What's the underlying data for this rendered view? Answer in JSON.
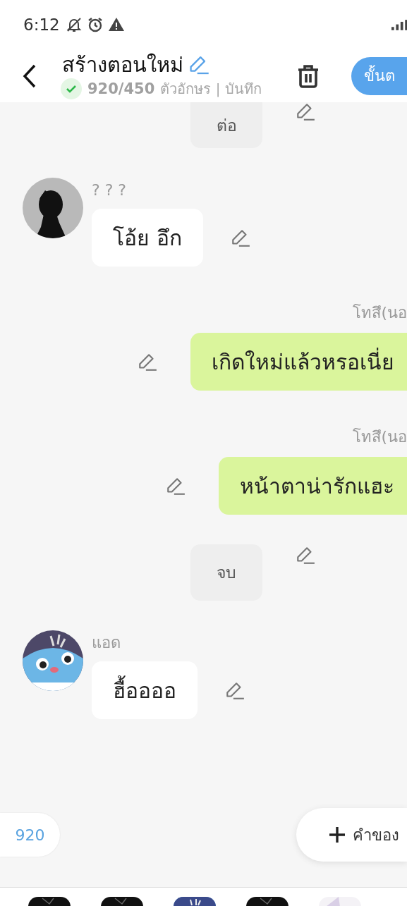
{
  "status_bar": {
    "time": "6:12"
  },
  "header": {
    "title": "สร้างตอนใหม่",
    "saved": true,
    "count": "920/450",
    "subtitle": "ตัวอักษร | บันทึก",
    "next_button": "ขั้นต"
  },
  "messages": [
    {
      "kind": "narration",
      "text": "ต่อ"
    },
    {
      "kind": "left",
      "name": "? ? ?",
      "text": "โอ้ย อึก",
      "avatar": {
        "kind": "picture"
      }
    },
    {
      "kind": "right",
      "name": "โทสึ(นอ",
      "text": "เกิดใหม่แล้วหรอเนี่ย"
    },
    {
      "kind": "right",
      "name": "โทสึ(นอ",
      "text": "หน้าตาน่ารักแฮะ"
    },
    {
      "kind": "narration",
      "text": "จบ"
    },
    {
      "kind": "left",
      "name": "แอด",
      "text": "ฮื้ออออ",
      "avatar": {
        "kind": "picture"
      }
    }
  ],
  "word_count": "920",
  "add_button": "คำของ",
  "characters": [
    {
      "kind": "picture"
    },
    {
      "kind": "picture"
    },
    {
      "kind": "picture",
      "selected": true
    },
    {
      "kind": "picture"
    },
    {
      "kind": "picture"
    }
  ]
}
